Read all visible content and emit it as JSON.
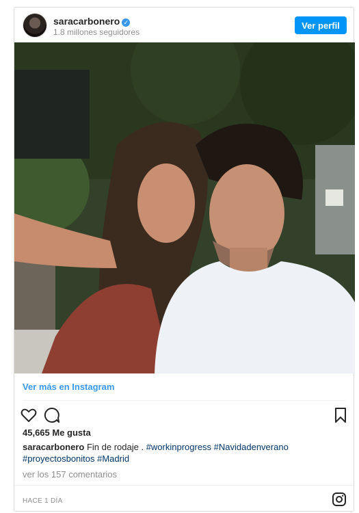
{
  "post": {
    "username": "saracarbonero",
    "verified_icon": "verified-badge-icon",
    "followers": "1.8 millones seguidores",
    "profile_button": "Ver perfil",
    "photo_alt": "",
    "view_more": "Ver más en Instagram",
    "likes": "45,665 Me gusta",
    "caption": {
      "user": "saracarbonero",
      "text": "Fin de rodaje .",
      "tags_line1": "#workinprogress #Navidadenverano",
      "tags_line2": "#proyectosbonitos #Madrid"
    },
    "comments_link": "ver los 157 comentarios",
    "time": "HACE 1 DÍA"
  },
  "icons": {
    "like": "heart-icon",
    "comment": "comment-icon",
    "save": "bookmark-icon",
    "brand": "instagram-icon"
  },
  "colors": {
    "accent": "#0095f6",
    "link": "#3897f0",
    "hashtag": "#003569",
    "muted": "#8e8e8e"
  }
}
